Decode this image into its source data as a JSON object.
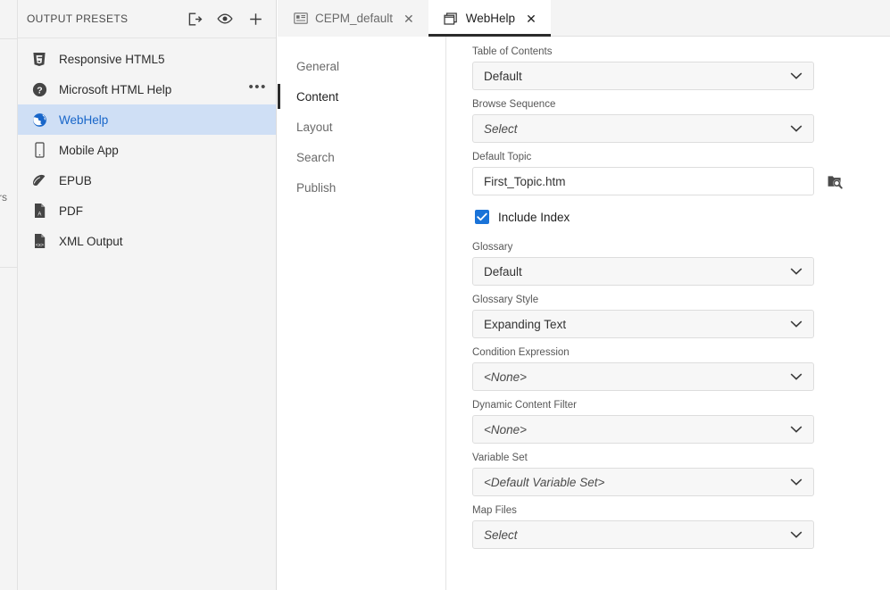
{
  "far_left": {
    "clipped_text": "rs"
  },
  "presets_panel": {
    "title": "OUTPUT PRESETS",
    "header_icons": [
      {
        "name": "build-output-icon",
        "title": "Build"
      },
      {
        "name": "preview-eye-icon",
        "title": "Preview"
      },
      {
        "name": "add-plus-icon",
        "title": "Add"
      }
    ],
    "items": [
      {
        "label": "Responsive HTML5",
        "icon": "html5-icon",
        "selected": false,
        "more": false
      },
      {
        "label": "Microsoft HTML Help",
        "icon": "help-question-icon",
        "selected": false,
        "more": true,
        "more_label": "•••"
      },
      {
        "label": "WebHelp",
        "icon": "globe-icon",
        "selected": true,
        "more": false
      },
      {
        "label": "Mobile App",
        "icon": "mobile-phone-icon",
        "selected": false,
        "more": false
      },
      {
        "label": "EPUB",
        "icon": "epub-book-icon",
        "selected": false,
        "more": false
      },
      {
        "label": "PDF",
        "icon": "pdf-file-icon",
        "selected": false,
        "more": false
      },
      {
        "label": "XML Output",
        "icon": "xml-file-icon",
        "selected": false,
        "more": false
      }
    ]
  },
  "tabs": [
    {
      "label": "CEPM_default",
      "icon": "document-pane-icon",
      "close_label": "✕",
      "active": false
    },
    {
      "label": "WebHelp",
      "icon": "window-icon",
      "close_label": "✕",
      "active": true
    }
  ],
  "inner_nav": {
    "items": [
      {
        "label": "General",
        "active": false
      },
      {
        "label": "Content",
        "active": true
      },
      {
        "label": "Layout",
        "active": false
      },
      {
        "label": "Search",
        "active": false
      },
      {
        "label": "Publish",
        "active": false
      }
    ]
  },
  "form": {
    "fields": [
      {
        "label": "Table of Contents",
        "type": "select",
        "value": "Default",
        "italic": false
      },
      {
        "label": "Browse Sequence",
        "type": "select",
        "value": "Select",
        "italic": true
      },
      {
        "label": "Default Topic",
        "type": "text",
        "value": "First_Topic.htm",
        "placeholder": "",
        "browse_icon": "folder-search-icon"
      },
      {
        "label": "Include Index",
        "type": "checkbox",
        "checked": true
      },
      {
        "label": "Glossary",
        "type": "select",
        "value": "Default",
        "italic": false
      },
      {
        "label": "Glossary Style",
        "type": "select",
        "value": "Expanding Text",
        "italic": false
      },
      {
        "label": "Condition Expression",
        "type": "select",
        "value": "<None>",
        "italic": true
      },
      {
        "label": "Dynamic Content Filter",
        "type": "select",
        "value": "<None>",
        "italic": true
      },
      {
        "label": "Variable Set",
        "type": "select",
        "value": "<Default Variable Set>",
        "italic": true
      },
      {
        "label": "Map Files",
        "type": "select",
        "value": "Select",
        "italic": true
      }
    ]
  },
  "colors": {
    "accent_blue": "#1866c9",
    "selection_blue": "#cfdff5",
    "checkbox_blue": "#1a73d8",
    "panel_grey": "#f4f4f4"
  }
}
